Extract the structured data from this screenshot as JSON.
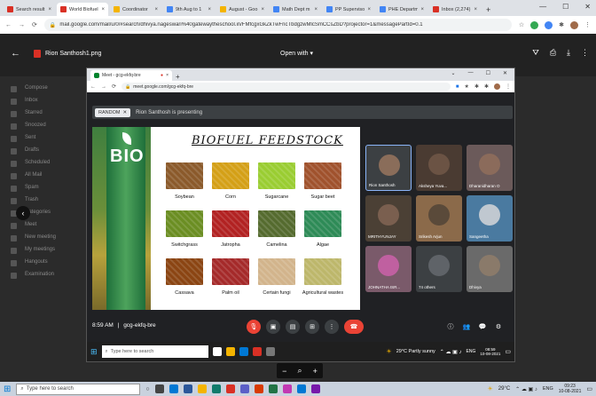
{
  "browser": {
    "tabs": [
      {
        "label": "Search result",
        "color": "#d93025"
      },
      {
        "label": "World Biofuel",
        "color": "#d93025"
      },
      {
        "label": "Coordinator",
        "color": "#f4b400"
      },
      {
        "label": "9th Aug to 1",
        "color": "#4285f4"
      },
      {
        "label": "August - Goo",
        "color": "#f4b400"
      },
      {
        "label": "Math Dept m",
        "color": "#4285f4"
      },
      {
        "label": "PP Supervisor",
        "color": "#4285f4"
      },
      {
        "label": "PHE Departm",
        "color": "#4285f4"
      },
      {
        "label": "Inbox (2,274)",
        "color": "#d93025"
      }
    ],
    "tab_close": "×",
    "new_tab": "+",
    "url": "mail.google.com/mail/u/0/#search/dhivya.nageswari%40gatewaytheschool.in/FMfcgxGkZkTwFncTbdgzwMlcSmCCsZbD?projector=1&messagePartId=0.1"
  },
  "viewer": {
    "file_name": "Rion Santhosh1.png",
    "open_with": "Open with"
  },
  "gmail_bg": {
    "items": [
      "Compose",
      "Inbox",
      "Starred",
      "Snoozed",
      "Sent",
      "Drafts",
      "Scheduled",
      "All Mail",
      "Spam",
      "Trash",
      "Categories",
      "Meet",
      "New meeting",
      "My meetings",
      "Hangouts",
      "Examination"
    ]
  },
  "inner": {
    "tab_label": "Meet - gcg-ekfq-bre",
    "url": "meet.google.com/gcg-ekfq-bre",
    "random_chip": "RANDOM",
    "presenting": "Rion Santhosh is presenting"
  },
  "slide": {
    "brand": "BIO",
    "title": "BIOFUEL FEEDSTOCK",
    "crops": [
      {
        "label": "Soybean",
        "color": "#8b5a2b"
      },
      {
        "label": "Corn",
        "color": "#d4a017"
      },
      {
        "label": "Sugarcane",
        "color": "#9acd32"
      },
      {
        "label": "Sugar beet",
        "color": "#a0522d"
      },
      {
        "label": "Switchgrass",
        "color": "#6b8e23"
      },
      {
        "label": "Jatropha",
        "color": "#b22222"
      },
      {
        "label": "Camelina",
        "color": "#556b2f"
      },
      {
        "label": "Algae",
        "color": "#2e8b57"
      },
      {
        "label": "Cassava",
        "color": "#8b4513"
      },
      {
        "label": "Palm oil",
        "color": "#a52a2a"
      },
      {
        "label": "Certain fungi",
        "color": "#d2b48c"
      },
      {
        "label": "Agricultural wastes",
        "color": "#bdb76b"
      }
    ]
  },
  "participants": [
    {
      "name": "Rion Santhosh",
      "bg": "#3c4043",
      "av": "#8a6d5a"
    },
    {
      "name": "Aksheya Yuva...",
      "bg": "#4a3b32",
      "av": "#6b5344"
    },
    {
      "name": "Dharanidharan O",
      "bg": "#6b5a5a",
      "av": "#8b6b5b"
    },
    {
      "name": "MRITHYUNJAY",
      "bg": "#4b4035",
      "av": "#7a5f4f"
    },
    {
      "name": "Srikesh Arjun",
      "bg": "#8b6a4a",
      "av": "#5a4a3a"
    },
    {
      "name": "Sangeetha",
      "bg": "#4a7aa0",
      "av": "#c0c8d0"
    },
    {
      "name": "JOHNATHA ISR...",
      "bg": "#7a5a6a",
      "av": "#c060a0"
    },
    {
      "name": "74 others",
      "bg": "#3c4043",
      "av": "#5f6368"
    },
    {
      "name": "Dhivya",
      "bg": "#6a6a6a",
      "av": "#8a7a6a"
    }
  ],
  "meet": {
    "time": "8:59 AM",
    "separator": "|",
    "code": "gcg-ekfq-bre",
    "end_color": "#ea4335"
  },
  "inner_taskbar": {
    "search": "Type here to search",
    "weather": "29°C  Partly sunny",
    "lang": "ENG",
    "time": "08:59",
    "date": "10-08-2021"
  },
  "zoom": {
    "minus": "−",
    "plus": "+"
  },
  "taskbar": {
    "search": "Type here to search",
    "weather": "29°C",
    "lang": "ENG",
    "time": "09:23",
    "date": "10-08-2021"
  }
}
